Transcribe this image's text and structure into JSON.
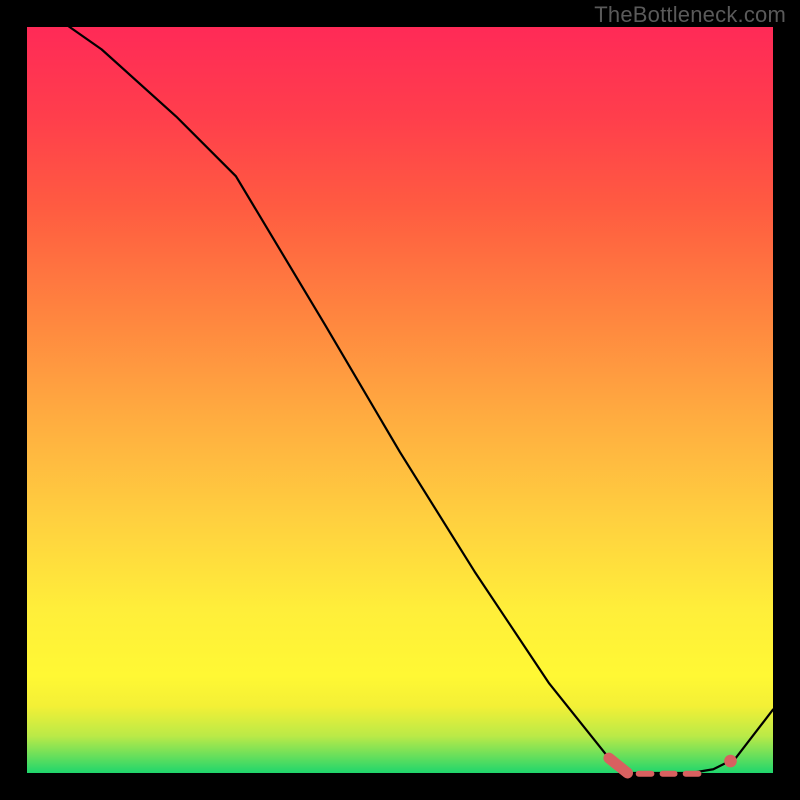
{
  "watermark": "TheBottleneck.com",
  "colors": {
    "bg": "#000000",
    "curve": "#000000",
    "marker": "#d86060"
  },
  "chart_data": {
    "type": "line",
    "title": "",
    "xlabel": "",
    "ylabel": "",
    "xlim": [
      0,
      100
    ],
    "ylim": [
      0,
      100
    ],
    "series": [
      {
        "name": "bottleneck-curve",
        "x": [
          0,
          10,
          20,
          28,
          40,
          50,
          60,
          70,
          78,
          80.5,
          83,
          86,
          89,
          92,
          95,
          100
        ],
        "values": [
          104,
          97,
          88,
          80,
          60,
          43,
          27,
          12,
          2,
          0,
          0,
          0,
          0,
          0.5,
          2,
          8.5
        ]
      }
    ],
    "highlight": {
      "cap_start": {
        "x": 78,
        "y": 2
      },
      "cap_end": {
        "x": 80.5,
        "y": 0
      },
      "dashes": [
        {
          "x0": 82,
          "y0": -0.1,
          "x1": 83.7,
          "y1": -0.1
        },
        {
          "x0": 85.2,
          "y0": -0.1,
          "x1": 86.8,
          "y1": -0.1
        },
        {
          "x0": 88.3,
          "y0": -0.1,
          "x1": 90,
          "y1": -0.1
        }
      ],
      "dot": {
        "x": 94.3,
        "y": 1.6,
        "r": 0.85
      }
    },
    "gradient_stops": [
      {
        "pct": 0,
        "color": "#1fd66c"
      },
      {
        "pct": 5,
        "color": "#bbea47"
      },
      {
        "pct": 13,
        "color": "#fff834"
      },
      {
        "pct": 34,
        "color": "#ffd03f"
      },
      {
        "pct": 62,
        "color": "#ff833f"
      },
      {
        "pct": 88,
        "color": "#ff3e4c"
      },
      {
        "pct": 100,
        "color": "#ff2a57"
      }
    ]
  }
}
